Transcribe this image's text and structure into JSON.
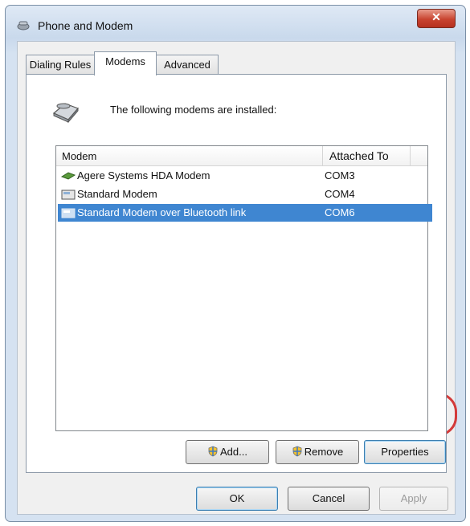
{
  "window": {
    "title": "Phone and Modem",
    "close_symbol": "✕"
  },
  "tabs": [
    {
      "label": "Dialing Rules",
      "active": false
    },
    {
      "label": "Modems",
      "active": true
    },
    {
      "label": "Advanced",
      "active": false
    }
  ],
  "panel": {
    "intro_text": "The following modems are installed:",
    "icon": "modem-icon",
    "columns": [
      "Modem",
      "Attached To"
    ],
    "rows": [
      {
        "name": "Agere Systems HDA Modem",
        "port": "COM3",
        "icon": "modem-card-icon",
        "selected": false
      },
      {
        "name": "Standard Modem",
        "port": "COM4",
        "icon": "modem-device-icon",
        "selected": false
      },
      {
        "name": "Standard Modem over Bluetooth link",
        "port": "COM6",
        "icon": "modem-device-icon",
        "selected": true
      }
    ],
    "buttons": {
      "add": "Add...",
      "remove": "Remove",
      "properties": "Properties"
    }
  },
  "footer": {
    "ok": "OK",
    "cancel": "Cancel",
    "apply": "Apply"
  },
  "colors": {
    "selection": "#3f86d1",
    "annotation_red": "#c72b2b"
  }
}
